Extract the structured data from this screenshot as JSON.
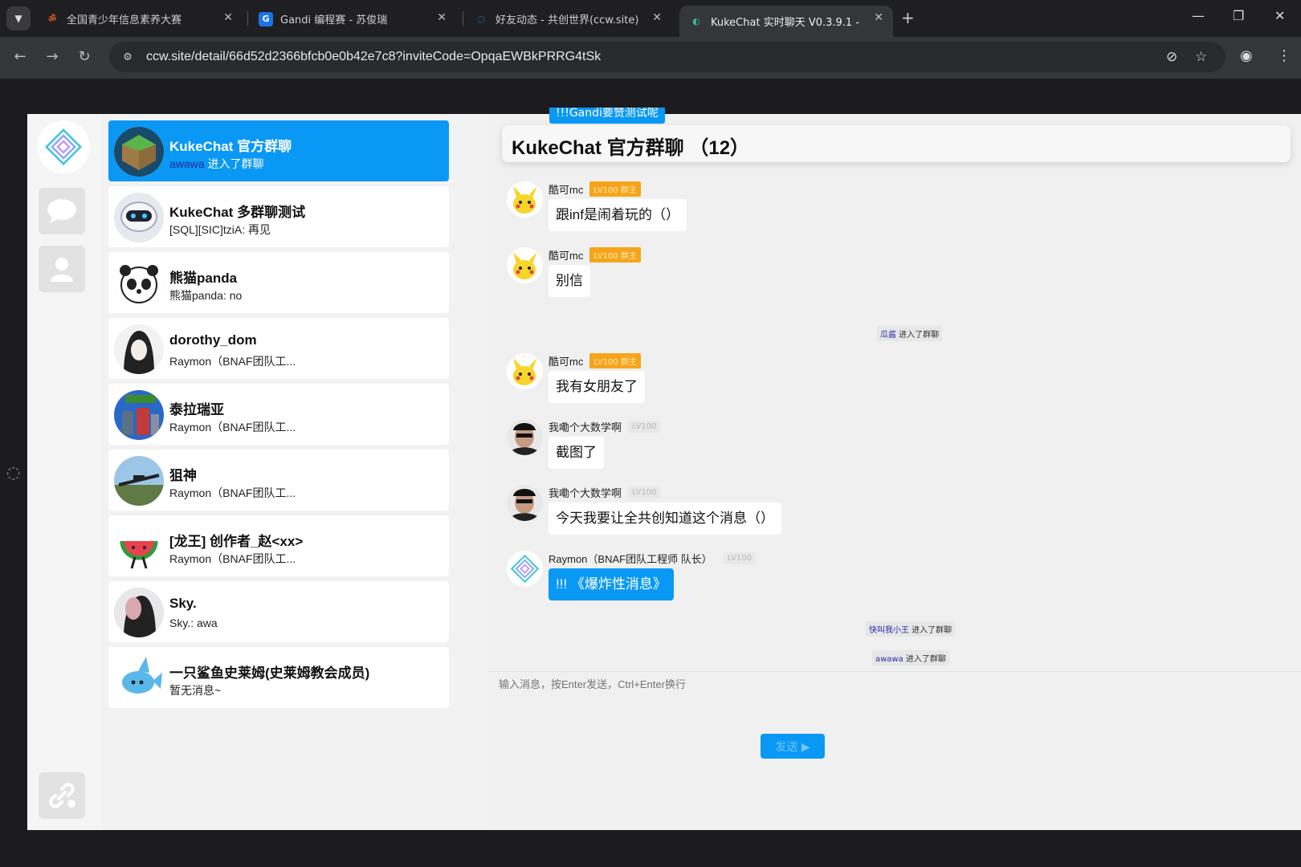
{
  "browser": {
    "tabs": [
      {
        "title": "全国青少年信息素养大赛",
        "active": false
      },
      {
        "title": "Gandi 编程赛 - 苏俊瑞",
        "active": false
      },
      {
        "title": "好友动态 - 共创世界(ccw.site)",
        "active": false
      },
      {
        "title": "KukeChat 实时聊天 V0.3.9.1 -",
        "active": true
      }
    ],
    "url": "ccw.site/detail/66d52d2366bfcb0e0b42e7c8?inviteCode=OpqaEWBkPRRG4tSk"
  },
  "conversations": [
    {
      "name": "KukeChat 官方群聊",
      "preview_who": "awawa",
      "preview_text": " 进入了群聊",
      "active": true
    },
    {
      "name": "KukeChat 多群聊测试",
      "preview_who": "",
      "preview_text": "[SQL][SIC]tziA: 再见"
    },
    {
      "name": "熊猫panda",
      "preview_who": "",
      "preview_text": "熊猫panda: no"
    },
    {
      "name": "dorothy_dom",
      "preview_who": "",
      "preview_text": "Raymon（BNAF团队工..."
    },
    {
      "name": "泰拉瑞亚",
      "preview_who": "",
      "preview_text": "Raymon（BNAF团队工..."
    },
    {
      "name": "狙神",
      "preview_who": "",
      "preview_text": "Raymon（BNAF团队工..."
    },
    {
      "name": "[龙王] 创作者_赵<xx>",
      "preview_who": "",
      "preview_text": "Raymon（BNAF团队工..."
    },
    {
      "name": "Sky.",
      "preview_who": "",
      "preview_text": "Sky.: awa"
    },
    {
      "name": "一只鲨鱼史莱姆(史莱姆教会成员)",
      "preview_who": "",
      "preview_text": "暂无消息~"
    }
  ],
  "chat": {
    "banner": "!!!Gandi要赞测试呢",
    "title": "KukeChat 官方群聊 （12）",
    "messages": [
      {
        "sender": "酷可mc",
        "level": "LV100 群主",
        "text": "跟inf是闹着玩的（）"
      },
      {
        "sender": "酷可mc",
        "level": "LV100 群主",
        "text": "别信"
      },
      {
        "sender": "酷可mc",
        "level": "LV100 群主",
        "text": "我有女朋友了"
      },
      {
        "sender": "我嘞个大数学啊",
        "level": "LV100",
        "text": "截图了"
      },
      {
        "sender": "我嘞个大数学啊",
        "level": "LV100",
        "text": "今天我要让全共创知道这个消息（）"
      },
      {
        "sender": "Raymon（BNAF团队工程师 队长）",
        "level": "LV100",
        "text": "!!! 《爆炸性消息》"
      }
    ],
    "system": [
      {
        "who": "瓜酱",
        "text": " 进入了群聊"
      },
      {
        "who": "快叫我小王",
        "text": " 进入了群聊"
      },
      {
        "who": "awawa",
        "text": " 进入了群聊"
      }
    ],
    "composer_placeholder": "输入消息，按Enter发送，Ctrl+Enter换行",
    "send_label": "发送 ▶"
  }
}
